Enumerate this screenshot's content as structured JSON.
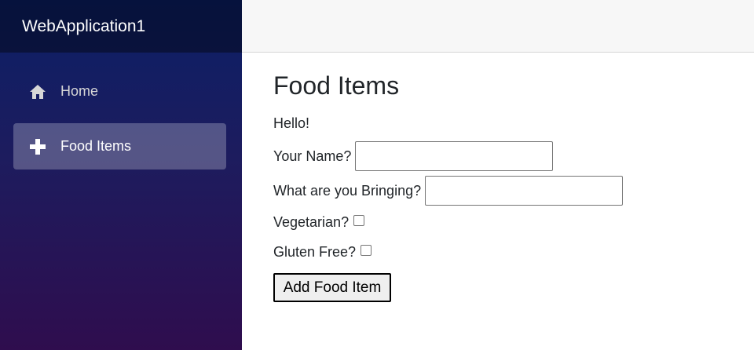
{
  "app": {
    "brand": "WebApplication1"
  },
  "sidebar": {
    "items": [
      {
        "label": "Home",
        "icon": "home-icon",
        "active": false
      },
      {
        "label": "Food Items",
        "icon": "plus-icon",
        "active": true
      }
    ]
  },
  "main": {
    "title": "Food Items",
    "greeting": "Hello!",
    "form": {
      "name_label": "Your Name?",
      "name_value": "",
      "bringing_label": "What are you Bringing?",
      "bringing_value": "",
      "vegetarian_label": "Vegetarian?",
      "vegetarian_checked": false,
      "gluten_free_label": "Gluten Free?",
      "gluten_free_checked": false,
      "submit_label": "Add Food Item"
    }
  },
  "colors": {
    "sidebar_gradient_top": "#0b1f66",
    "sidebar_gradient_bottom": "#2f0d4e",
    "top_row_bg": "#f7f7f7"
  }
}
